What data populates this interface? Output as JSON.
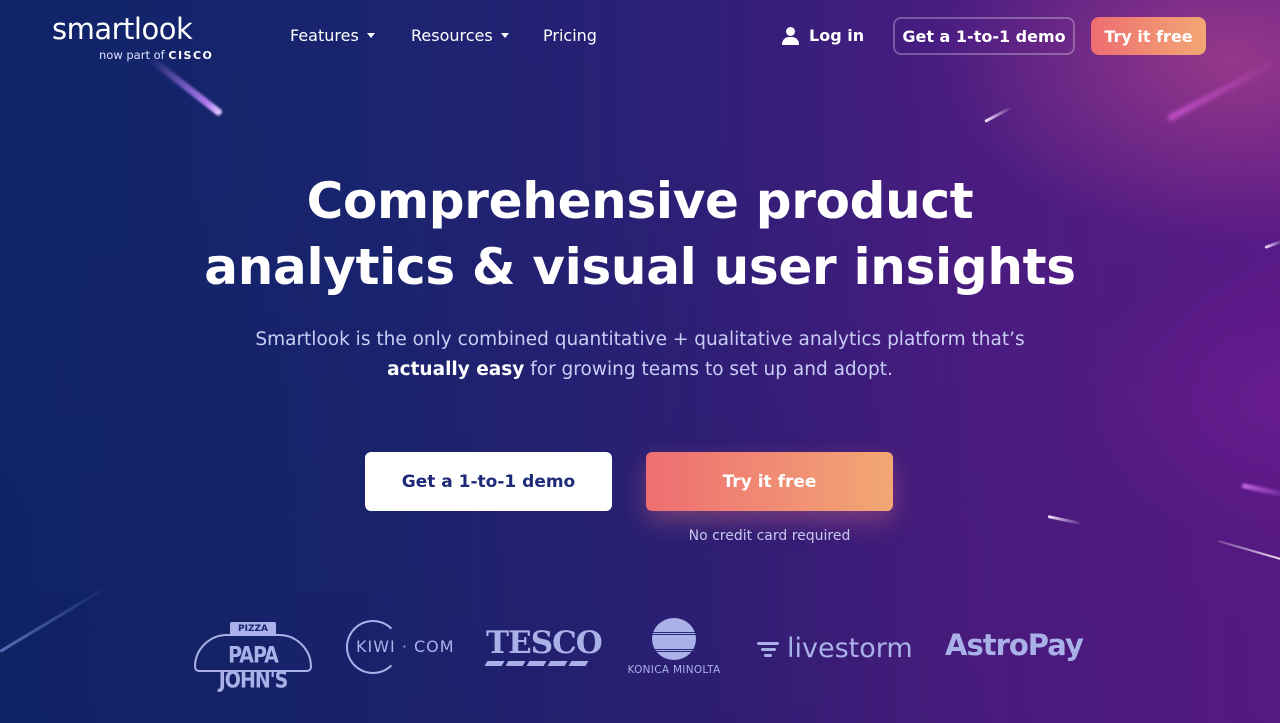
{
  "nav": {
    "logo": {
      "wordmark": "smartlook",
      "tagline_prefix": "now part of",
      "tagline_brand": "CISCO"
    },
    "links": [
      {
        "label": "Features",
        "has_dropdown": true
      },
      {
        "label": "Resources",
        "has_dropdown": true
      },
      {
        "label": "Pricing",
        "has_dropdown": false
      }
    ],
    "login_label": "Log in",
    "demo_button_label": "Get a 1-to-1 demo",
    "trial_button_label": "Try it free"
  },
  "hero": {
    "title_line1": "Comprehensive product",
    "title_line2": "analytics & visual user insights",
    "subtitle_line1": "Smartlook is the only combined quantitative + qualitative analytics platform that’s",
    "subtitle_emphasis": "actually easy",
    "subtitle_line2_rest": " for growing teams to set up and adopt.",
    "primary_cta_label": "Get a 1-to-1 demo",
    "secondary_cta_label": "Try it free",
    "cta_note": "No credit card required"
  },
  "customer_logos": [
    {
      "name": "Papa John's",
      "top": "PIZZA",
      "text": "PAPA JOHN'S"
    },
    {
      "name": "Kiwi.com",
      "text": "KIWI · COM"
    },
    {
      "name": "Tesco",
      "text": "TESCO"
    },
    {
      "name": "Konica Minolta",
      "text": "KONICA MINOLTA"
    },
    {
      "name": "Livestorm",
      "text": "livestorm"
    },
    {
      "name": "AstroPay",
      "text": "AstroPay"
    }
  ],
  "colors": {
    "bg_left": "#0f2468",
    "bg_right": "#5a1a88",
    "cta_gradient_start": "#ee6e72",
    "cta_gradient_end": "#f2a774",
    "demo_text": "#1e2a78",
    "logo_tint": "#a9b1e8"
  }
}
